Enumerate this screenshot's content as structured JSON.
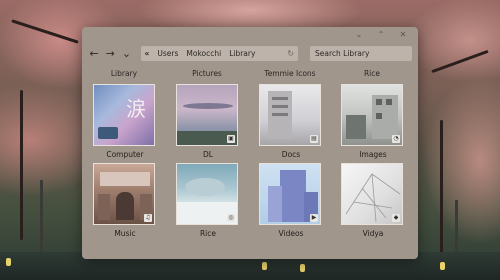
{
  "window": {
    "controls": {
      "minimize_icon": "⌄",
      "maximize_icon": "⌃",
      "close_icon": "✕"
    }
  },
  "toolbar": {
    "back_icon": "←",
    "forward_icon": "→",
    "dropdown_icon": "⌄",
    "breadcrumb_prefix": "«",
    "breadcrumb": [
      "Users",
      "Mokocchi",
      "Library"
    ],
    "reload_icon": "↻",
    "search_placeholder": "Search Library"
  },
  "column_headers": [
    "Library",
    "Pictures",
    "Temmie Icons",
    "Rice"
  ],
  "items": [
    {
      "label": "Computer",
      "badge": "",
      "thumb": "computer",
      "kanji": "涙"
    },
    {
      "label": "DL",
      "badge": "▣",
      "thumb": "dl"
    },
    {
      "label": "Docs",
      "badge": "▤",
      "thumb": "docs"
    },
    {
      "label": "Images",
      "badge": "◔",
      "thumb": "images"
    },
    {
      "label": "Music",
      "badge": "♫",
      "thumb": "music"
    },
    {
      "label": "Rice",
      "badge": "◎",
      "thumb": "rice"
    },
    {
      "label": "Videos",
      "badge": "▶",
      "thumb": "videos"
    },
    {
      "label": "Vidya",
      "badge": "◆",
      "thumb": "vidya"
    }
  ],
  "colors": {
    "window_bg": "#a1968c",
    "field_bg": "#bdb3aa",
    "text": "#2b2622"
  }
}
